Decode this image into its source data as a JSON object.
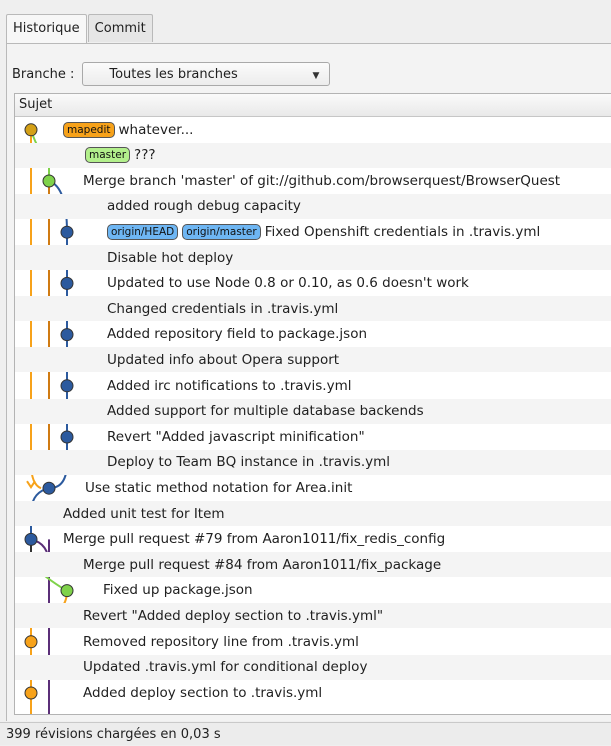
{
  "tabs": [
    {
      "label": "Historique",
      "active": true
    },
    {
      "label": "Commit",
      "active": false
    }
  ],
  "branch": {
    "label": "Branche :",
    "value": "Toutes les branches"
  },
  "list": {
    "header": "Sujet"
  },
  "colors": {
    "orange": "#f7a21a",
    "green": "#7fd24a",
    "blue": "#2c5a9e",
    "purple": "#5b2f78",
    "ref_blue": "#6eb6f3"
  },
  "commits": [
    {
      "refs": [
        {
          "label": "mapedit",
          "color": "orange"
        }
      ],
      "subject": "whatever..."
    },
    {
      "refs": [
        {
          "label": "master",
          "color": "green"
        }
      ],
      "subject": "???"
    },
    {
      "refs": [],
      "subject": "Merge branch 'master' of git://github.com/browserquest/BrowserQuest"
    },
    {
      "refs": [],
      "subject": "added rough debug capacity"
    },
    {
      "refs": [
        {
          "label": "origin/HEAD",
          "color": "blue"
        },
        {
          "label": "origin/master",
          "color": "blue"
        }
      ],
      "subject": "Fixed Openshift credentials in .travis.yml"
    },
    {
      "refs": [],
      "subject": "Disable hot deploy"
    },
    {
      "refs": [],
      "subject": "Updated to use Node 0.8 or 0.10, as 0.6 doesn't work"
    },
    {
      "refs": [],
      "subject": "Changed credentials in .travis.yml"
    },
    {
      "refs": [],
      "subject": "Added repository field to package.json"
    },
    {
      "refs": [],
      "subject": "Updated info about Opera support"
    },
    {
      "refs": [],
      "subject": "Added irc notifications to .travis.yml"
    },
    {
      "refs": [],
      "subject": "Added support for multiple database backends"
    },
    {
      "refs": [],
      "subject": "Revert \"Added javascript minification\""
    },
    {
      "refs": [],
      "subject": "Deploy to Team BQ instance in .travis.yml"
    },
    {
      "refs": [],
      "subject": "Use static method notation for Area.init"
    },
    {
      "refs": [],
      "subject": "Added unit test for Item"
    },
    {
      "refs": [],
      "subject": "Merge pull request #79 from Aaron1011/fix_redis_config"
    },
    {
      "refs": [],
      "subject": "Merge pull request #84 from Aaron1011/fix_package"
    },
    {
      "refs": [],
      "subject": "Fixed up package.json"
    },
    {
      "refs": [],
      "subject": "Revert \"Added deploy section to .travis.yml\""
    },
    {
      "refs": [],
      "subject": "Removed repository line from .travis.yml"
    },
    {
      "refs": [],
      "subject": "Updated .travis.yml for conditional deploy"
    },
    {
      "refs": [],
      "subject": "Added deploy section to .travis.yml"
    }
  ],
  "status": "399 révisions chargées en 0,03 s"
}
